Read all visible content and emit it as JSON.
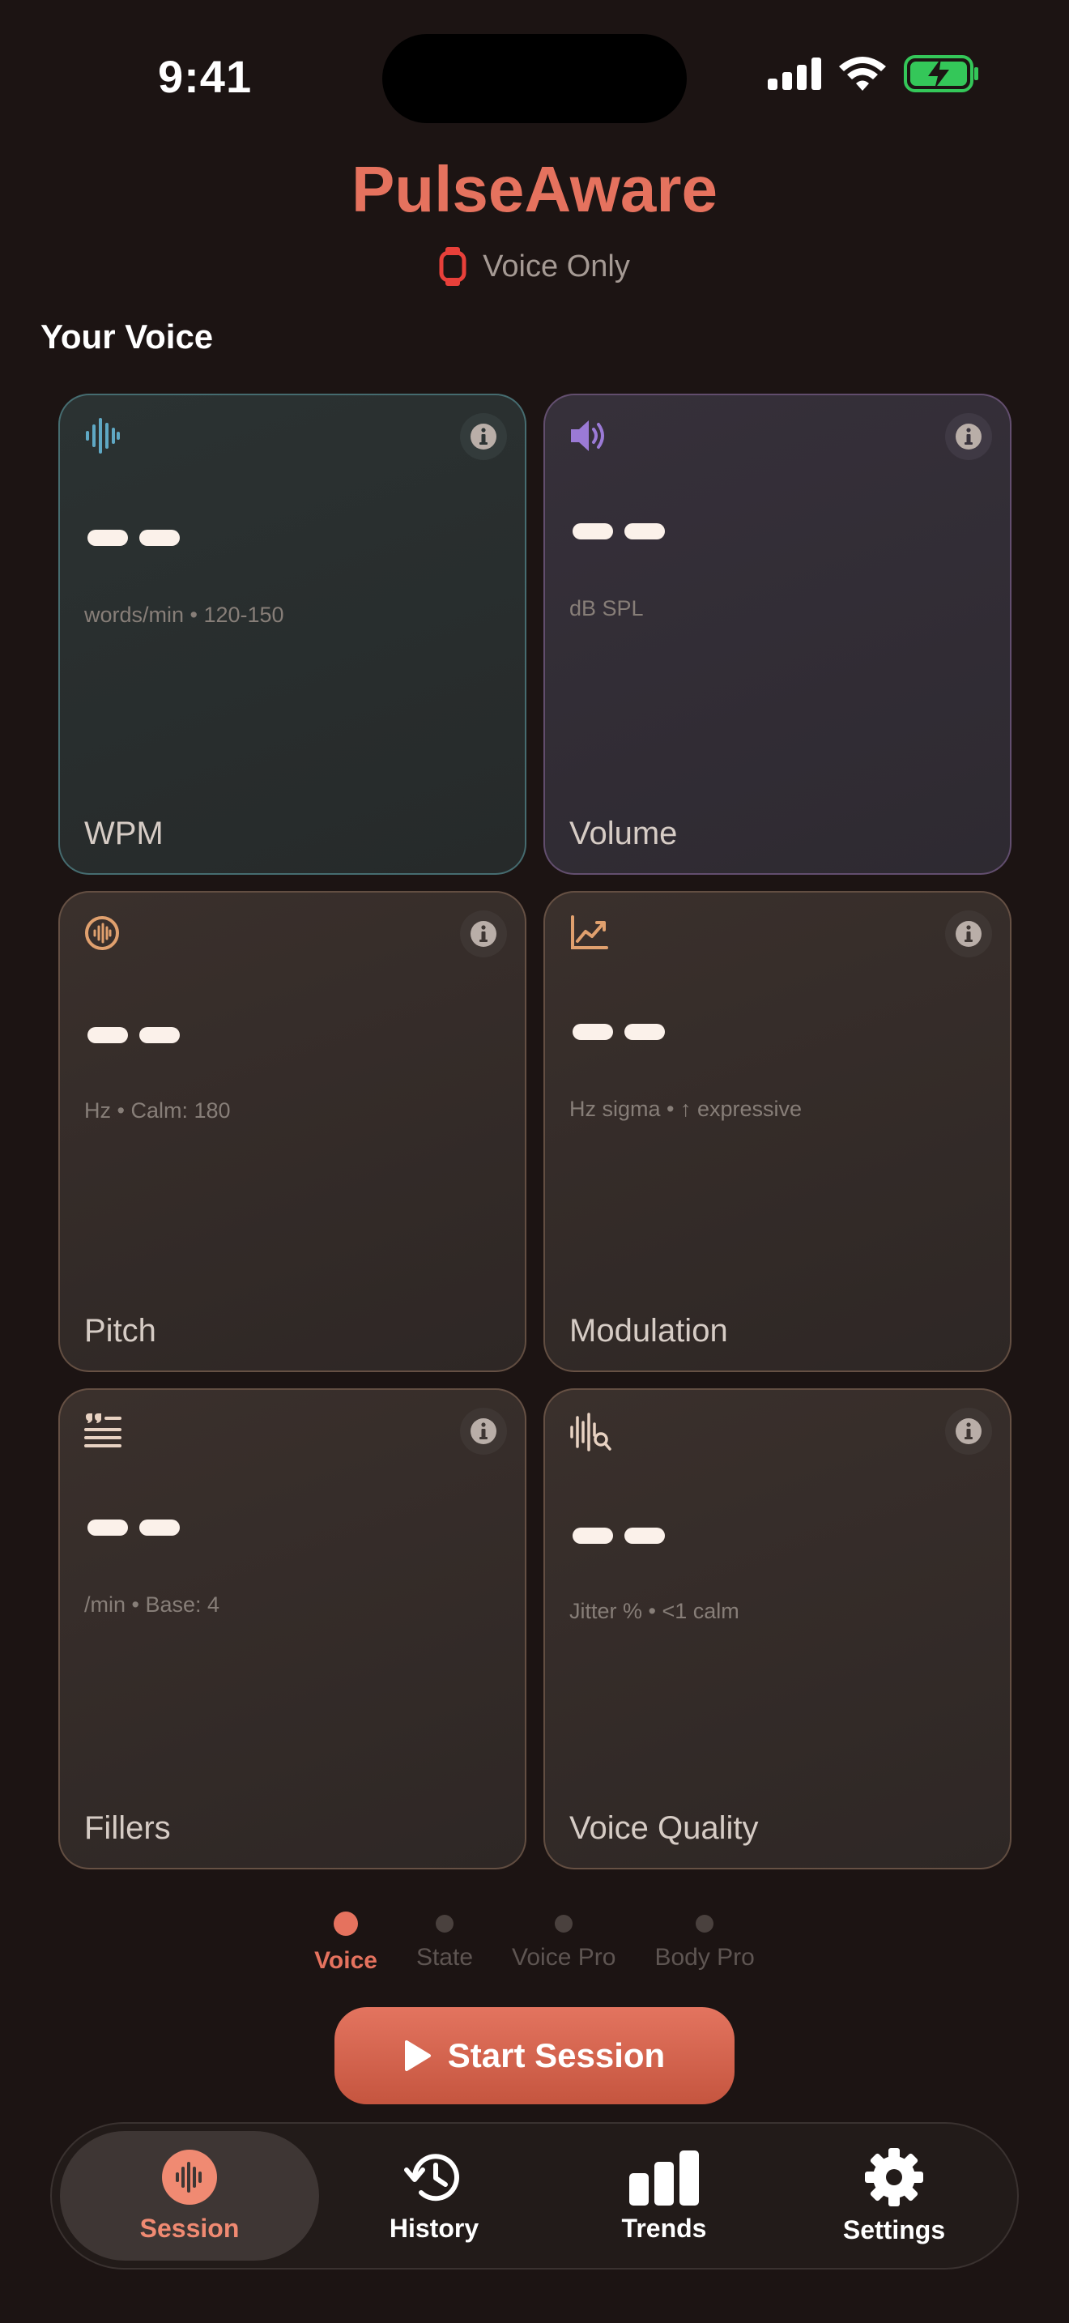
{
  "status_bar": {
    "time": "9:41",
    "icons": [
      "cellular-signal-icon",
      "wifi-icon",
      "battery-charging-icon"
    ]
  },
  "header": {
    "title": "PulseAware",
    "mode_icon": "watch-icon",
    "mode_label": "Voice Only"
  },
  "section_title": "Your Voice",
  "cards": [
    {
      "label": "WPM",
      "value": "– –",
      "unit": "words/min • 120-150",
      "icon": "waveform-icon",
      "accent": "#5fa8c4"
    },
    {
      "label": "Volume",
      "value": "– –",
      "unit": "dB SPL",
      "icon": "speaker-icon",
      "accent": "#9b7ad6"
    },
    {
      "label": "Pitch",
      "value": "– –",
      "unit": "Hz • Calm: 180",
      "icon": "waveform-circle-icon",
      "accent": "#e0a06e"
    },
    {
      "label": "Modulation",
      "value": "– –",
      "unit": "Hz sigma • ↑ expressive",
      "icon": "trend-chart-icon",
      "accent": "#e0a06e"
    },
    {
      "label": "Fillers",
      "value": "– –",
      "unit": "/min • Base: 4",
      "icon": "quote-list-icon",
      "accent": "#e8d2c2"
    },
    {
      "label": "Voice Quality",
      "value": "– –",
      "unit": "Jitter % • <1 calm",
      "icon": "waveform-search-icon",
      "accent": "#e8d2c2"
    }
  ],
  "pager": [
    {
      "label": "Voice",
      "active": true
    },
    {
      "label": "State",
      "active": false
    },
    {
      "label": "Voice Pro",
      "active": false
    },
    {
      "label": "Body Pro",
      "active": false
    }
  ],
  "start_button": {
    "label": "Start Session",
    "icon": "play-icon"
  },
  "tabs": [
    {
      "label": "Session",
      "icon": "waveform-circle-icon",
      "active": true
    },
    {
      "label": "History",
      "icon": "clock-history-icon",
      "active": false
    },
    {
      "label": "Trends",
      "icon": "bar-chart-icon",
      "active": false
    },
    {
      "label": "Settings",
      "icon": "gear-icon",
      "active": false
    }
  ],
  "colors": {
    "accent": "#e5725e",
    "background": "#1c1413",
    "battery_green": "#34c759"
  }
}
